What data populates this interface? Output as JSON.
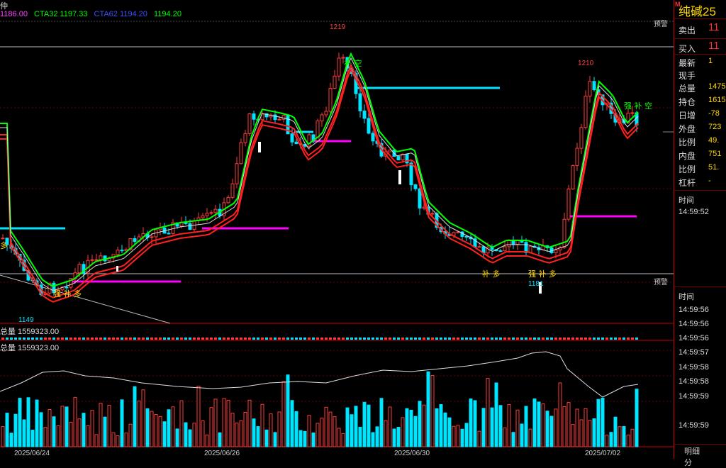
{
  "header": {
    "corner_label": "仲",
    "ma": [
      {
        "label": "1186.00",
        "color": "#ff40ff"
      },
      {
        "label": "CTA32 1197.33",
        "color": "#00ff00"
      },
      {
        "label": "CTA62 1194.20",
        "color": "#3a50ff"
      },
      {
        "label": "1194.20",
        "color": "#00ff00"
      }
    ]
  },
  "price_labels": {
    "high_1219": "1219",
    "high_1210": "1210",
    "low_1149": "1149",
    "low_1181": "1181",
    "warn_top": "预警",
    "warn_bottom": "预警"
  },
  "signals": {
    "sig1": "强 补 多",
    "sig2": "补 多",
    "sig3": "强 补 多",
    "sig4": "强 补 空",
    "sig5": "补 空",
    "sig6": "多"
  },
  "volume": {
    "label1": "总量 1559323.00",
    "label2": "总量 1559323.00"
  },
  "dates": [
    "2025/06/24",
    "2025/06/26",
    "2025/06/30",
    "2025/07/02"
  ],
  "side": {
    "title": "纯碱25",
    "badge": "M",
    "rows": [
      {
        "label": "卖出",
        "value": "11",
        "red": true
      },
      {
        "label": "买入",
        "value": "11",
        "red": true
      },
      {
        "label": "最新",
        "value": "1"
      },
      {
        "label": "现手",
        "value": ""
      },
      {
        "label": "总量",
        "value": "1475"
      },
      {
        "label": "持仓",
        "value": "1615"
      },
      {
        "label": "日增",
        "value": "-78"
      },
      {
        "label": "外盘",
        "value": "723"
      },
      {
        "label": "比例",
        "value": "49."
      },
      {
        "label": "内盘",
        "value": "751"
      },
      {
        "label": "比例",
        "value": "51."
      },
      {
        "label": "杠杆",
        "value": "-"
      }
    ],
    "time_header1": "时间",
    "time_first": "14:59:52",
    "time_header2": "时间",
    "times": [
      "14:59:56",
      "14:59:56",
      "14:59:56",
      "14:59:57",
      "14:59:58",
      "14:59:58",
      "14:59:59",
      "14:59:59"
    ],
    "tab1": "明细",
    "tab2": "分"
  },
  "colors": {
    "up": "#ff3a3a",
    "down": "#00e5ff",
    "ma_green": "#00ff00",
    "ma_red": "#ff2020",
    "support": "#00e5ff",
    "resist": "#ff00ff"
  }
}
